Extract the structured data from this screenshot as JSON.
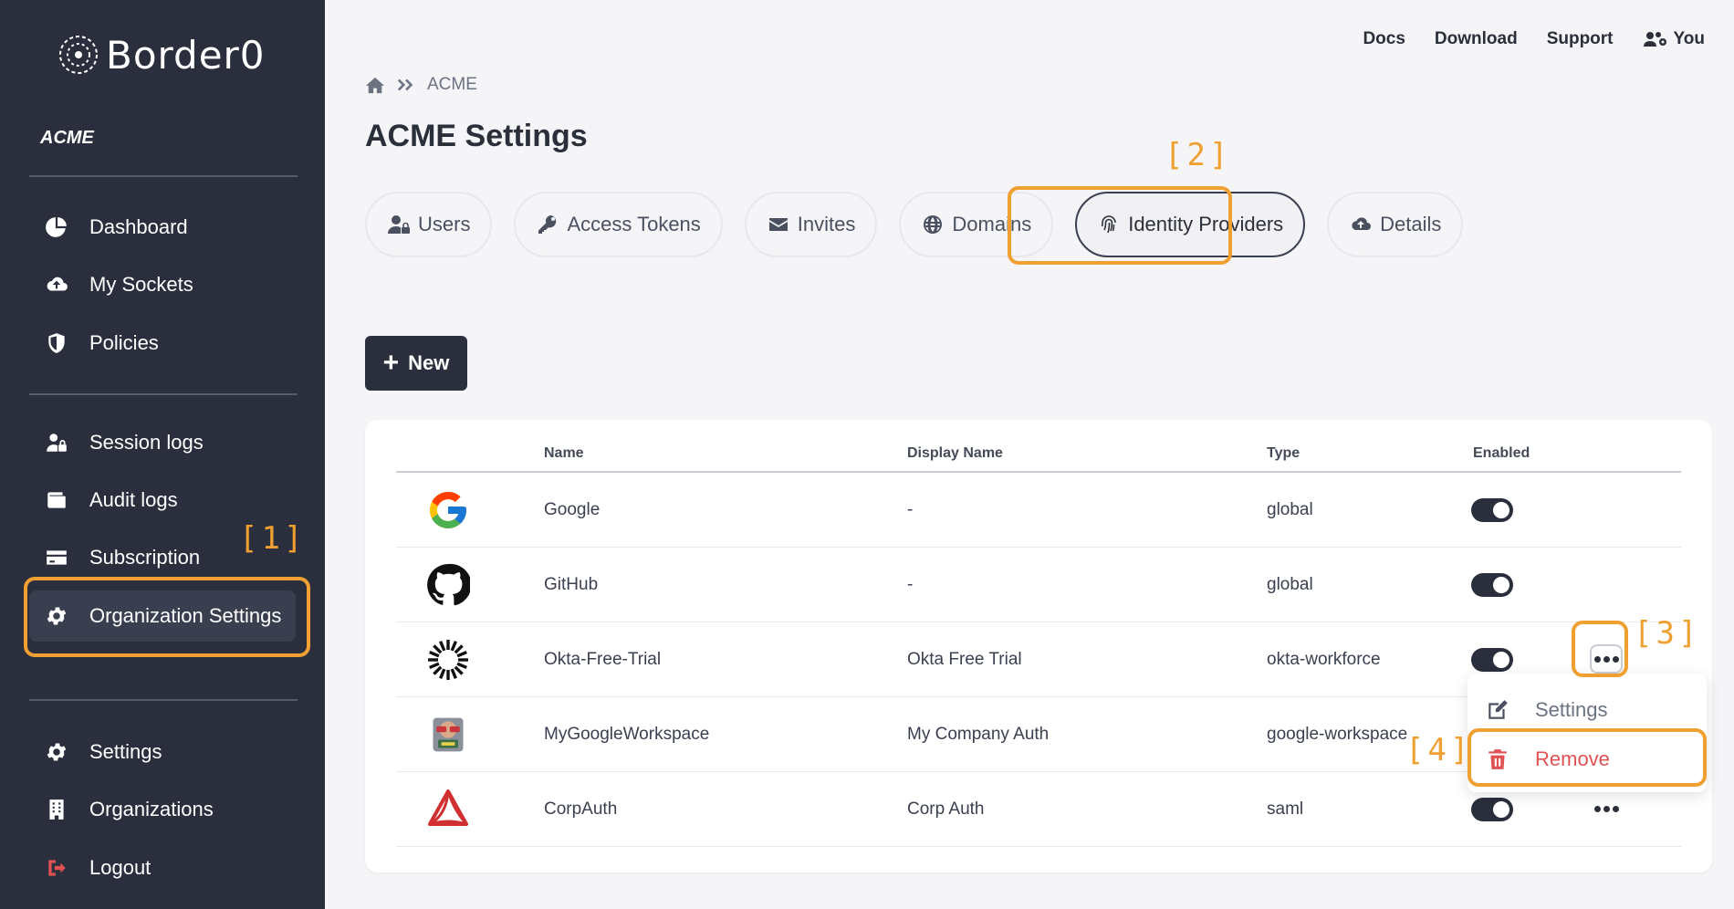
{
  "brand": {
    "name": "Border0"
  },
  "organization": {
    "name": "ACME"
  },
  "sidebar": {
    "items": [
      {
        "label": "Dashboard",
        "icon": "chart-pie-icon"
      },
      {
        "label": "My Sockets",
        "icon": "cloud-upload-icon"
      },
      {
        "label": "Policies",
        "icon": "shield-icon"
      },
      {
        "label": "Session logs",
        "icon": "user-lock-icon"
      },
      {
        "label": "Audit logs",
        "icon": "wallet-icon"
      },
      {
        "label": "Subscription",
        "icon": "credit-card-icon"
      },
      {
        "label": "Organization Settings",
        "icon": "gear-icon"
      },
      {
        "label": "Settings",
        "icon": "gear-icon"
      },
      {
        "label": "Organizations",
        "icon": "building-icon"
      },
      {
        "label": "Logout",
        "icon": "sign-out-icon"
      }
    ]
  },
  "topnav": {
    "docs": "Docs",
    "download": "Download",
    "support": "Support",
    "you": "You"
  },
  "breadcrumb": {
    "current": "ACME"
  },
  "page": {
    "title": "ACME Settings"
  },
  "tabs": [
    {
      "label": "Users",
      "icon": "user-lock-icon"
    },
    {
      "label": "Access Tokens",
      "icon": "key-icon"
    },
    {
      "label": "Invites",
      "icon": "envelope-icon"
    },
    {
      "label": "Domains",
      "icon": "globe-icon"
    },
    {
      "label": "Identity Providers",
      "icon": "fingerprint-icon",
      "active": true
    },
    {
      "label": "Details",
      "icon": "cloud-upload-icon"
    }
  ],
  "toolbar": {
    "new_label": "New"
  },
  "table": {
    "columns": [
      "Name",
      "Display Name",
      "Type",
      "Enabled"
    ],
    "rows": [
      {
        "name": "Google",
        "display_name": "-",
        "type": "global",
        "enabled": true,
        "logo": "google-logo"
      },
      {
        "name": "GitHub",
        "display_name": "-",
        "type": "global",
        "enabled": true,
        "logo": "github-logo"
      },
      {
        "name": "Okta-Free-Trial",
        "display_name": "Okta Free Trial",
        "type": "okta-workforce",
        "enabled": true,
        "logo": "okta-logo"
      },
      {
        "name": "MyGoogleWorkspace",
        "display_name": "My Company Auth",
        "type": "google-workspace",
        "enabled": true,
        "logo": "workspace-logo"
      },
      {
        "name": "CorpAuth",
        "display_name": "Corp Auth",
        "type": "saml",
        "enabled": true,
        "logo": "corpauth-logo"
      }
    ]
  },
  "row_menu": {
    "settings": "Settings",
    "remove": "Remove"
  },
  "annotations": {
    "a1": "[1]",
    "a2": "[2]",
    "a3": "[3]",
    "a4": "[4]"
  },
  "colors": {
    "sidebar": "#2b2f3d",
    "highlight": "#f0a030",
    "danger": "#e05252"
  }
}
